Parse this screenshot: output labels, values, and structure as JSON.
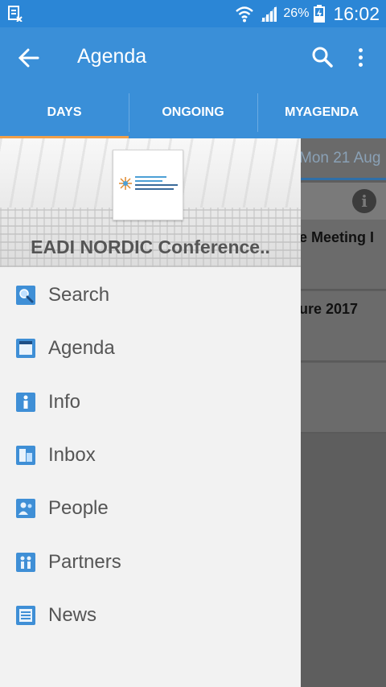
{
  "status_bar": {
    "battery": "26%",
    "time": "16:02"
  },
  "app_bar": {
    "title": "Agenda"
  },
  "tabs": [
    {
      "label": "DAYS",
      "active": true
    },
    {
      "label": "ONGOING",
      "active": false
    },
    {
      "label": "MYAGENDA",
      "active": false
    }
  ],
  "background": {
    "date": "Mon 21 Aug",
    "items": [
      "e Meeting I",
      "ure 2017"
    ]
  },
  "drawer": {
    "conference_name": "EADI NORDIC Conference..",
    "items": [
      {
        "label": "Search",
        "icon": "search-icon"
      },
      {
        "label": "Agenda",
        "icon": "agenda-icon"
      },
      {
        "label": "Info",
        "icon": "info-icon"
      },
      {
        "label": "Inbox",
        "icon": "inbox-icon"
      },
      {
        "label": "People",
        "icon": "people-icon"
      },
      {
        "label": "Partners",
        "icon": "partners-icon"
      },
      {
        "label": "News",
        "icon": "news-icon"
      }
    ]
  },
  "colors": {
    "primary": "#3a8fd8",
    "status_bar": "#2b86d6",
    "tab_indicator": "#f0a04b",
    "drawer_bg": "#f2f2f2"
  }
}
